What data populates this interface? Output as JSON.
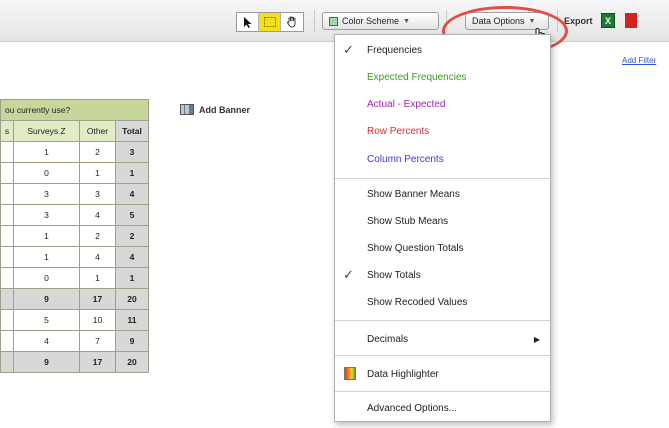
{
  "toolbar": {
    "color_scheme_label": "Color Scheme",
    "data_options_label": "Data Options",
    "export_label": "Export",
    "excel_icon_letter": "X",
    "tool_icons": [
      "arrow-cursor-icon",
      "select-box-icon",
      "hand-icon"
    ]
  },
  "add_filter_label": "Add Filter",
  "add_banner_label": "Add Banner",
  "crosstab": {
    "question": "ou currently use?",
    "columns": [
      "s",
      "Surveys Z",
      "Other",
      "Total"
    ],
    "rows": [
      {
        "cells": [
          "",
          "1",
          "2",
          "3"
        ],
        "total": false
      },
      {
        "cells": [
          "",
          "0",
          "1",
          "1"
        ],
        "total": false
      },
      {
        "cells": [
          "",
          "3",
          "3",
          "4"
        ],
        "total": false
      },
      {
        "cells": [
          "",
          "3",
          "4",
          "5"
        ],
        "total": false
      },
      {
        "cells": [
          "",
          "1",
          "2",
          "2"
        ],
        "total": false
      },
      {
        "cells": [
          "",
          "1",
          "4",
          "4"
        ],
        "total": false
      },
      {
        "cells": [
          "",
          "0",
          "1",
          "1"
        ],
        "total": false
      },
      {
        "cells": [
          "",
          "9",
          "17",
          "20"
        ],
        "total": true
      },
      {
        "cells": [
          "",
          "5",
          "10",
          "11"
        ],
        "total": false
      },
      {
        "cells": [
          "",
          "4",
          "7",
          "9"
        ],
        "total": false
      },
      {
        "cells": [
          "",
          "9",
          "17",
          "20"
        ],
        "total": true
      }
    ]
  },
  "menu": {
    "items": [
      {
        "label": "Frequencies",
        "checked": true
      },
      {
        "label": "Expected Frequencies",
        "color": "#3a9d23"
      },
      {
        "label": "Actual - Expected",
        "color": "#9c27b0"
      },
      {
        "label": "Row Percents",
        "color": "#d32f2f"
      },
      {
        "label": "Column Percents",
        "color": "#3b3bd6"
      },
      {
        "label": "Show Banner Means"
      },
      {
        "label": "Show Stub Means"
      },
      {
        "label": "Show Question Totals"
      },
      {
        "label": "Show Totals",
        "checked": true
      },
      {
        "label": "Show Recoded Values"
      },
      {
        "label": "Decimals",
        "submenu": true
      },
      {
        "label": "Data Highlighter",
        "icon": "data-highlighter-icon"
      },
      {
        "label": "Advanced Options..."
      }
    ],
    "check_glyph": "✓",
    "submenu_glyph": "▶"
  },
  "colors": {
    "highlight_ring": "#e24d44",
    "question_header": "#c7d79c",
    "column_header": "#e1ebc4",
    "total_cell": "#d7d7d7"
  }
}
